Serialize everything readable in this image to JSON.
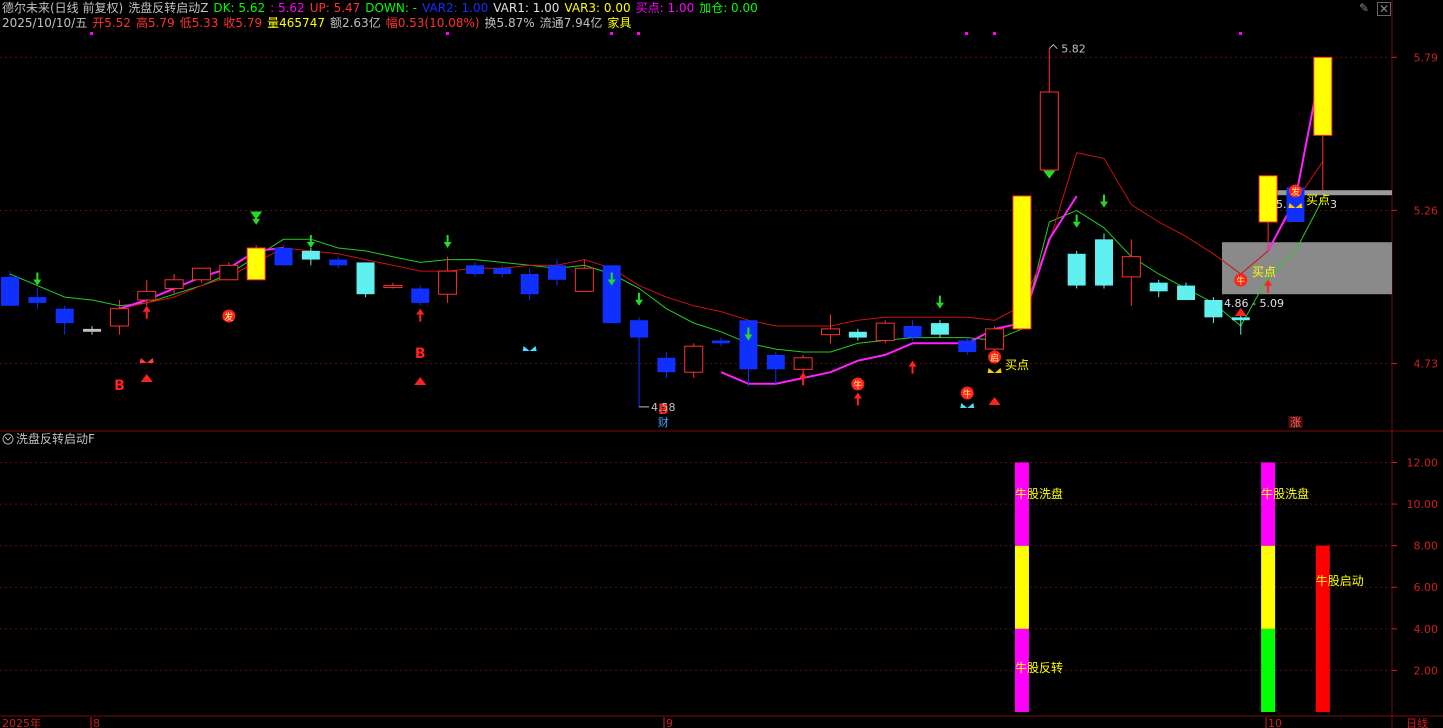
{
  "header": {
    "line1": [
      {
        "text": "德尔未来(日线 前复权)",
        "color": "#c0c0c0"
      },
      {
        "text": "洗盘反转启动Z",
        "color": "#c0c0c0"
      },
      {
        "text": "DK: 5.62",
        "color": "#00ff00"
      },
      {
        "text": ": 5.62",
        "color": "#ff00ff"
      },
      {
        "text": "UP: 5.47",
        "color": "#ff3030"
      },
      {
        "text": "DOWN: -",
        "color": "#00ff00"
      },
      {
        "text": "VAR2: 1.00",
        "color": "#1030ff"
      },
      {
        "text": "VAR1: 1.00",
        "color": "#e0e0e0"
      },
      {
        "text": "VAR3: 0.00",
        "color": "#ffff00"
      },
      {
        "text": "买点: 1.00",
        "color": "#ff00ff"
      },
      {
        "text": "加仓: 0.00",
        "color": "#00ff00"
      }
    ],
    "line2": [
      {
        "text": "2025/10/10/五",
        "color": "#c0c0c0"
      },
      {
        "text": "开5.52",
        "color": "#ff3030"
      },
      {
        "text": "高5.79",
        "color": "#ff3030"
      },
      {
        "text": "低5.33",
        "color": "#ff3030"
      },
      {
        "text": "收5.79",
        "color": "#ff3030"
      },
      {
        "text": "量465747",
        "color": "#ffff00"
      },
      {
        "text": "额2.63亿",
        "color": "#c0c0c0"
      },
      {
        "text": "幅0.53(10.08%)",
        "color": "#ff3030"
      },
      {
        "text": "换5.87%",
        "color": "#c0c0c0"
      },
      {
        "text": "流通7.94亿",
        "color": "#c0c0c0"
      },
      {
        "text": "家具",
        "color": "#ffff00"
      }
    ]
  },
  "main_axis": {
    "ticks": [
      "5.79",
      "5.26",
      "4.73"
    ]
  },
  "sub_panel": {
    "title": "洗盘反转启动F",
    "ticks": [
      "12.00",
      "10.00",
      "8.00",
      "6.00",
      "4.00",
      "2.00"
    ]
  },
  "x_axis": {
    "labels": [
      "2025年",
      "8",
      "9",
      "10",
      "日线"
    ]
  },
  "annotations": {
    "high_label": "5.82",
    "low_label": "4.58",
    "range_label": "4.86 - 5.09",
    "partial_label": "5.",
    "partial_label_right": "3",
    "buy_label": "买点",
    "buy_label2": "买点",
    "buy_label3": "买点",
    "b_marker": "B",
    "cai_marker": "财",
    "zhang_marker": "涨",
    "fa_icon": "发",
    "qi_icon": "启",
    "niu_icon": "牛"
  },
  "sub_labels": {
    "a": "牛股洗盘",
    "b": "牛股反转",
    "c": "牛股洗盘",
    "d": "牛股启动"
  },
  "colors": {
    "up": "#ff3030",
    "down_blue": "#1030ff",
    "cyan": "#60f0f0",
    "yellow": "#ffff00",
    "magenta": "#ff00ff",
    "green": "#00ff00"
  },
  "chart_data": {
    "type": "candlestick",
    "y_range": [
      4.5,
      5.85
    ],
    "indicator_y_range": [
      0,
      12.6
    ],
    "candles": [
      {
        "o": 5.03,
        "c": 4.93,
        "h": 5.05,
        "l": 4.93,
        "s": "blue"
      },
      {
        "o": 4.96,
        "c": 4.94,
        "h": 4.99,
        "l": 4.92,
        "s": "blue"
      },
      {
        "o": 4.92,
        "c": 4.87,
        "h": 4.93,
        "l": 4.83,
        "s": "blue"
      },
      {
        "o": 4.85,
        "c": 4.84,
        "h": 4.86,
        "l": 4.83,
        "s": "white"
      },
      {
        "o": 4.86,
        "c": 4.92,
        "h": 4.95,
        "l": 4.83,
        "s": "red"
      },
      {
        "o": 4.95,
        "c": 4.98,
        "h": 5.02,
        "l": 4.93,
        "s": "red"
      },
      {
        "o": 4.99,
        "c": 5.02,
        "h": 5.04,
        "l": 4.97,
        "s": "red"
      },
      {
        "o": 5.02,
        "c": 5.06,
        "h": 5.06,
        "l": 5.01,
        "s": "red"
      },
      {
        "o": 5.02,
        "c": 5.07,
        "h": 5.08,
        "l": 5.02,
        "s": "red"
      },
      {
        "o": 5.13,
        "c": 5.02,
        "h": 5.14,
        "l": 5.02,
        "s": "yellow"
      },
      {
        "o": 5.13,
        "c": 5.07,
        "h": 5.14,
        "l": 5.07,
        "s": "blue"
      },
      {
        "o": 5.12,
        "c": 5.09,
        "h": 5.13,
        "l": 5.07,
        "s": "cyan"
      },
      {
        "o": 5.09,
        "c": 5.07,
        "h": 5.1,
        "l": 5.06,
        "s": "blue"
      },
      {
        "o": 5.08,
        "c": 4.97,
        "h": 5.08,
        "l": 4.96,
        "s": "cyan"
      },
      {
        "o": 5.0,
        "c": 5.0,
        "h": 5.01,
        "l": 4.99,
        "s": "red"
      },
      {
        "o": 4.99,
        "c": 4.94,
        "h": 5.0,
        "l": 4.93,
        "s": "blue"
      },
      {
        "o": 4.97,
        "c": 5.05,
        "h": 5.1,
        "l": 4.94,
        "s": "red"
      },
      {
        "o": 5.07,
        "c": 5.04,
        "h": 5.08,
        "l": 5.03,
        "s": "blue"
      },
      {
        "o": 5.06,
        "c": 5.04,
        "h": 5.07,
        "l": 5.03,
        "s": "blue"
      },
      {
        "o": 5.04,
        "c": 4.97,
        "h": 5.06,
        "l": 4.95,
        "s": "blue"
      },
      {
        "o": 5.07,
        "c": 5.02,
        "h": 5.09,
        "l": 5.0,
        "s": "blue"
      },
      {
        "o": 4.98,
        "c": 5.06,
        "h": 5.09,
        "l": 4.98,
        "s": "red"
      },
      {
        "o": 5.07,
        "c": 4.87,
        "h": 5.07,
        "l": 4.87,
        "s": "blue"
      },
      {
        "o": 4.88,
        "c": 4.82,
        "h": 4.89,
        "l": 4.58,
        "s": "blue"
      },
      {
        "o": 4.75,
        "c": 4.7,
        "h": 4.77,
        "l": 4.68,
        "s": "blue"
      },
      {
        "o": 4.7,
        "c": 4.79,
        "h": 4.8,
        "l": 4.68,
        "s": "red"
      },
      {
        "o": 4.81,
        "c": 4.8,
        "h": 4.82,
        "l": 4.79,
        "s": "blue"
      },
      {
        "o": 4.88,
        "c": 4.71,
        "h": 4.88,
        "l": 4.65,
        "s": "blue"
      },
      {
        "o": 4.76,
        "c": 4.71,
        "h": 4.77,
        "l": 4.66,
        "s": "blue"
      },
      {
        "o": 4.71,
        "c": 4.75,
        "h": 4.76,
        "l": 4.66,
        "s": "red"
      },
      {
        "o": 4.83,
        "c": 4.85,
        "h": 4.9,
        "l": 4.8,
        "s": "red"
      },
      {
        "o": 4.84,
        "c": 4.82,
        "h": 4.85,
        "l": 4.81,
        "s": "cyan"
      },
      {
        "o": 4.81,
        "c": 4.87,
        "h": 4.88,
        "l": 4.8,
        "s": "red"
      },
      {
        "o": 4.86,
        "c": 4.82,
        "h": 4.88,
        "l": 4.81,
        "s": "blue"
      },
      {
        "o": 4.87,
        "c": 4.83,
        "h": 4.88,
        "l": 4.82,
        "s": "cyan"
      },
      {
        "o": 4.81,
        "c": 4.77,
        "h": 4.82,
        "l": 4.76,
        "s": "blue"
      },
      {
        "o": 4.78,
        "c": 4.85,
        "h": 4.86,
        "l": 4.77,
        "s": "red"
      },
      {
        "o": 4.85,
        "c": 5.31,
        "h": 5.31,
        "l": 4.85,
        "s": "yellow"
      },
      {
        "o": 5.4,
        "c": 5.67,
        "h": 5.82,
        "l": 5.4,
        "s": "red"
      },
      {
        "o": 5.11,
        "c": 5.0,
        "h": 5.12,
        "l": 4.99,
        "s": "cyan"
      },
      {
        "o": 5.16,
        "c": 5.0,
        "h": 5.18,
        "l": 4.99,
        "s": "cyan"
      },
      {
        "o": 5.1,
        "c": 5.03,
        "h": 5.16,
        "l": 4.93,
        "s": "red"
      },
      {
        "o": 5.01,
        "c": 4.98,
        "h": 5.02,
        "l": 4.96,
        "s": "cyan"
      },
      {
        "o": 5.0,
        "c": 4.95,
        "h": 5.01,
        "l": 4.95,
        "s": "cyan"
      },
      {
        "o": 4.95,
        "c": 4.89,
        "h": 4.96,
        "l": 4.87,
        "s": "cyan"
      },
      {
        "o": 4.89,
        "c": 4.88,
        "h": 4.9,
        "l": 4.83,
        "s": "cyan"
      },
      {
        "o": 5.22,
        "c": 5.38,
        "h": 5.38,
        "l": 5.12,
        "s": "yellow"
      },
      {
        "o": 5.22,
        "c": 5.34,
        "h": 5.34,
        "l": 5.22,
        "s": "blue"
      },
      {
        "o": 5.52,
        "c": 5.79,
        "h": 5.79,
        "l": 5.33,
        "s": "yellow"
      }
    ],
    "ma_green": [
      5.04,
      5.0,
      4.96,
      4.95,
      4.93,
      4.94,
      4.97,
      5.0,
      5.04,
      5.1,
      5.16,
      5.16,
      5.13,
      5.12,
      5.1,
      5.08,
      5.09,
      5.09,
      5.08,
      5.07,
      5.06,
      5.07,
      5.04,
      4.99,
      4.92,
      4.87,
      4.84,
      4.8,
      4.78,
      4.77,
      4.77,
      4.8,
      4.81,
      4.82,
      4.82,
      4.82,
      4.81,
      4.85,
      5.22,
      5.26,
      5.2,
      5.1,
      5.04,
      4.99,
      4.94,
      4.86,
      5.03,
      5.12,
      5.3
    ],
    "ma_red": [
      null,
      null,
      null,
      null,
      4.92,
      4.94,
      4.96,
      5.0,
      5.03,
      5.08,
      5.13,
      5.12,
      5.11,
      5.09,
      5.07,
      5.05,
      5.05,
      5.06,
      5.06,
      5.07,
      5.07,
      5.09,
      5.06,
      5.0,
      4.96,
      4.93,
      4.91,
      4.88,
      4.86,
      4.86,
      4.86,
      4.88,
      4.89,
      4.89,
      4.89,
      4.89,
      4.88,
      4.93,
      5.15,
      5.46,
      5.44,
      5.28,
      5.22,
      5.17,
      5.11,
      5.04,
      5.12,
      5.29,
      5.43
    ],
    "ma_magenta": [
      null,
      null,
      null,
      null,
      4.92,
      4.95,
      4.99,
      5.03,
      5.06,
      5.12,
      5.13,
      null,
      null,
      null,
      null,
      null,
      null,
      null,
      null,
      null,
      null,
      null,
      null,
      null,
      null,
      null,
      4.7,
      4.66,
      4.66,
      4.68,
      4.7,
      4.74,
      4.76,
      4.8,
      4.8,
      4.8,
      4.85,
      4.87,
      5.16,
      5.31,
      null,
      null,
      null,
      null,
      null,
      null,
      5.12,
      5.3,
      5.79
    ],
    "indicator_bars": [
      {
        "i": 37,
        "segments": [
          {
            "from": 0,
            "to": 4,
            "color": "#ff00ff"
          },
          {
            "from": 4,
            "to": 8,
            "color": "#ffff00"
          },
          {
            "from": 8,
            "to": 12,
            "color": "#ff00ff"
          }
        ]
      },
      {
        "i": 46,
        "segments": [
          {
            "from": 0,
            "to": 4,
            "color": "#00ff00"
          },
          {
            "from": 4,
            "to": 8,
            "color": "#ffff00"
          },
          {
            "from": 8,
            "to": 12,
            "color": "#ff00ff"
          }
        ]
      },
      {
        "i": 48,
        "segments": [
          {
            "from": 0,
            "to": 8,
            "color": "#ff0000"
          }
        ]
      }
    ]
  }
}
